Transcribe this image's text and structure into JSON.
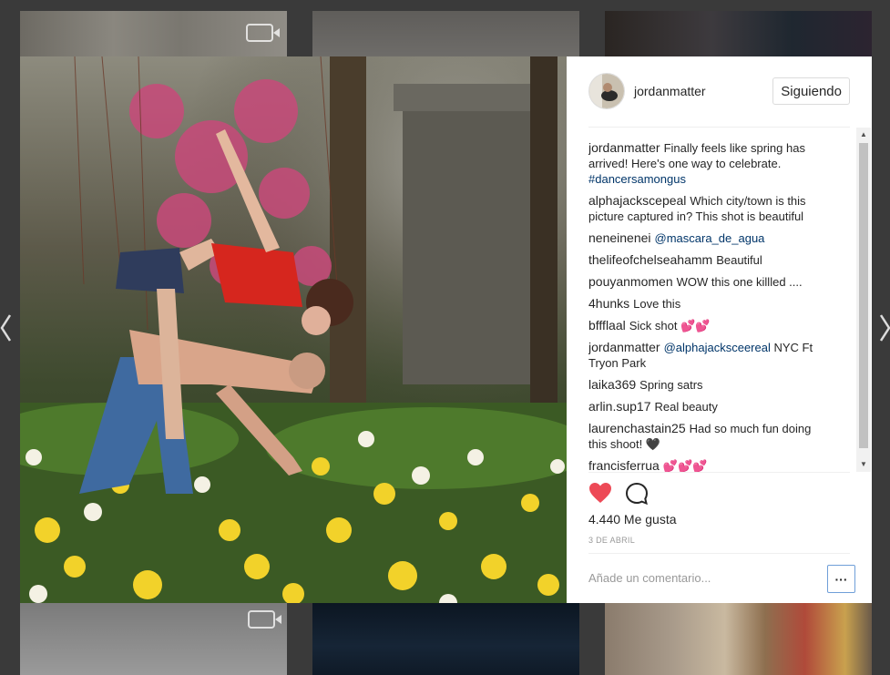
{
  "post": {
    "username": "jordanmatter",
    "follow_label": "Siguiendo",
    "likes": "4.440 Me gusta",
    "date": "3 DE ABRIL",
    "comment_placeholder": "Añade un comentario...",
    "more_label": "···"
  },
  "comments": [
    {
      "user": "jordanmatter",
      "text": "Finally feels like spring has arrived! Here's one way to celebrate.",
      "link": "#dancersamongus"
    },
    {
      "user": "alphajacksceреal",
      "text": "Which city/town is this picture captured in? This shot is beautiful",
      "link": ""
    },
    {
      "user": "neneinenei",
      "text": "",
      "link": "@mascara_de_agua"
    },
    {
      "user": "thelifeofchelseahamm",
      "text": "Beautiful",
      "link": ""
    },
    {
      "user": "pouyanmomen",
      "text": "WOW this one killled ....",
      "link": ""
    },
    {
      "user": "4hunks",
      "text": "Love this",
      "link": ""
    },
    {
      "user": "bffflaal",
      "text": "Sick shot 💕💕",
      "link": ""
    },
    {
      "user": "jordanmatter",
      "text": "NYC Ft Tryon Park",
      "link": "@alphajacksceereal",
      "link_first": true
    },
    {
      "user": "laika369",
      "text": "Spring satrs",
      "link": ""
    },
    {
      "user": "arlin.sup17",
      "text": "Real beauty",
      "link": ""
    },
    {
      "user": "laurenchastain25",
      "text": "Had so much fun doing this shoot! 🖤",
      "link": ""
    },
    {
      "user": "francisferrua",
      "text": "💕💕💕",
      "link": ""
    }
  ],
  "icons": {
    "like": "heart-icon",
    "comment": "comment-bubble-icon",
    "prev": "chevron-left-icon",
    "next": "chevron-right-icon"
  },
  "colors": {
    "like": "#ed4956",
    "link": "#003569",
    "text": "#262626",
    "muted": "#999999"
  }
}
